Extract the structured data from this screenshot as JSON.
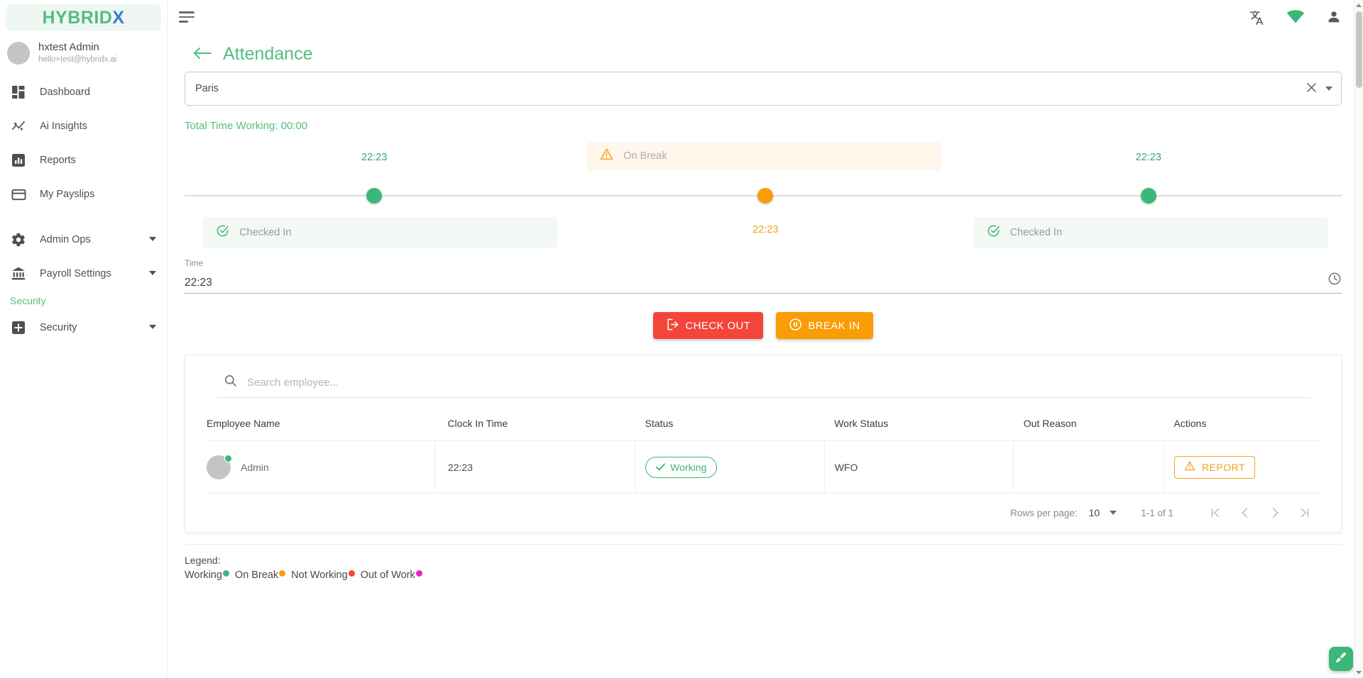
{
  "brand": {
    "logo_main": "HYBRID",
    "logo_x": "X",
    "accent_green": "#54bd7f",
    "accent_blue": "#3a7bd5"
  },
  "sidebar": {
    "user": {
      "name": "hxtest Admin",
      "email": "hello+test@hybridx.ai",
      "avatar": "user-avatar"
    },
    "items": [
      {
        "label": "Dashboard",
        "icon": "dashboard-icon",
        "expandable": false
      },
      {
        "label": "Ai Insights",
        "icon": "ai-insights-icon",
        "expandable": false
      },
      {
        "label": "Reports",
        "icon": "reports-icon",
        "expandable": false
      },
      {
        "label": "My Payslips",
        "icon": "payslips-icon",
        "expandable": false
      },
      {
        "label": "Admin Ops",
        "icon": "gear-icon",
        "expandable": true
      },
      {
        "label": "Payroll Settings",
        "icon": "bank-icon",
        "expandable": true
      }
    ],
    "section_label": "Security",
    "security_item": {
      "label": "Security",
      "icon": "plus-box-icon",
      "expandable": true
    }
  },
  "topbar": {
    "menu_icon": "hamburger-icon",
    "translate_icon": "translate-icon",
    "wifi_icon": "wifi-icon",
    "account_icon": "person-icon"
  },
  "header": {
    "back_icon": "back-arrow-icon",
    "title": "Attendance"
  },
  "location_select": {
    "value": "Paris",
    "clear_icon": "close-icon",
    "dropdown_icon": "chevron-down-icon"
  },
  "total_time": "Total Time Working: 00:00",
  "timeline": {
    "steps": [
      {
        "time": "22:23",
        "dot_color": "#3bb878",
        "card_label": "Checked In",
        "card_icon": "check-circle-icon",
        "left_pct": 16.4,
        "type": "checked-in"
      },
      {
        "time": "22:23",
        "dot_color": "#fa9c06",
        "banner_label": "On Break",
        "banner_icon": "warning-triangle-icon",
        "left_pct": 50.2,
        "type": "on-break"
      },
      {
        "time": "22:23",
        "dot_color": "#3bb878",
        "card_label": "Checked In",
        "card_icon": "check-circle-icon",
        "left_pct": 83.3,
        "type": "checked-in"
      }
    ]
  },
  "time_input": {
    "label": "Time",
    "value": "22:23",
    "clock_icon": "clock-icon"
  },
  "actions": {
    "check_out": {
      "label": "CHECK OUT",
      "icon": "logout-icon",
      "color": "#f4453a"
    },
    "break_in": {
      "label": "BREAK IN",
      "icon": "pause-circle-icon",
      "color": "#fa9c06"
    }
  },
  "employee_search": {
    "placeholder": "Search employee...",
    "value": "",
    "icon": "search-icon"
  },
  "table": {
    "columns": [
      "Employee Name",
      "Clock In Time",
      "Status",
      "Work Status",
      "Out Reason",
      "Actions"
    ],
    "rows": [
      {
        "employee_name": "Admin",
        "avatar": "employee-avatar",
        "presence_color": "#3bb878",
        "clock_in_time": "22:23",
        "status": "Working",
        "status_icon": "check-icon",
        "work_status": "WFO",
        "out_reason": "",
        "action_label": "REPORT",
        "action_icon": "warning-triangle-icon"
      }
    ]
  },
  "pagination": {
    "rows_per_page_label": "Rows per page:",
    "rows_per_page_value": "10",
    "range_label": "1-1 of 1",
    "first_icon": "first-page-icon",
    "prev_icon": "prev-page-icon",
    "next_icon": "next-page-icon",
    "last_icon": "last-page-icon"
  },
  "legend": {
    "title": "Legend:",
    "items": [
      {
        "label": "Working",
        "color": "#3bb878"
      },
      {
        "label": "On Break",
        "color": "#fa9c06"
      },
      {
        "label": "Not Working",
        "color": "#f4453a"
      },
      {
        "label": "Out of Work",
        "color": "#ec22c8"
      }
    ]
  },
  "fab": {
    "icon": "brush-icon",
    "color": "#3bb878"
  }
}
